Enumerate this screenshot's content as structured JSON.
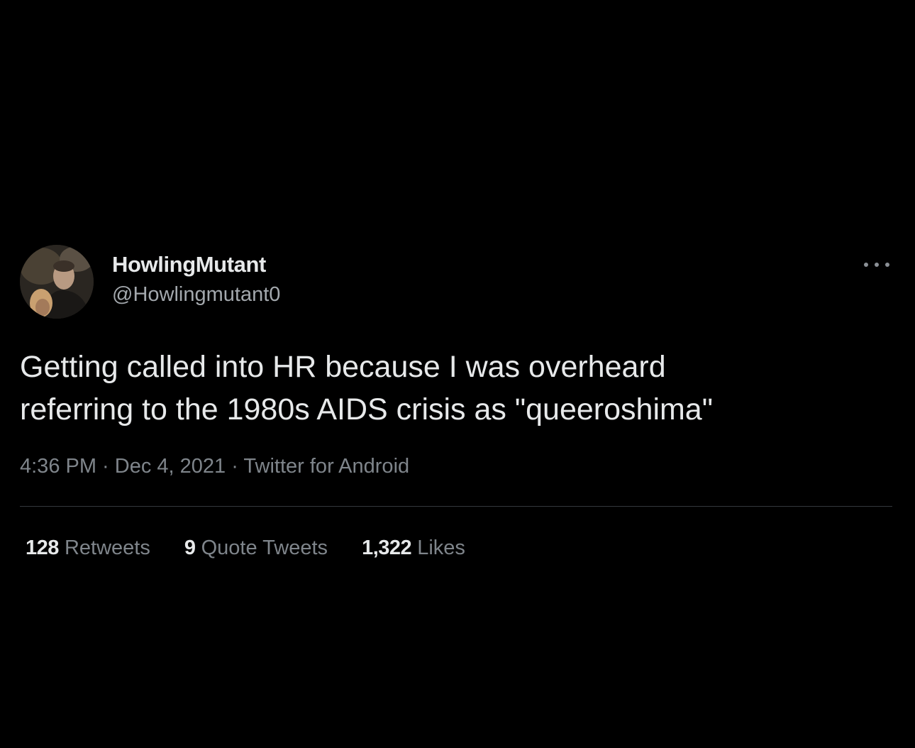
{
  "tweet": {
    "display_name": "HowlingMutant",
    "handle": "@Howlingmutant0",
    "text_lines": [
      "Getting called into HR because I was overheard",
      "referring to the 1980s AIDS crisis as \"queeroshima\""
    ],
    "time": "4:36 PM",
    "date": "Dec 4, 2021",
    "source": "Twitter for Android",
    "separator": " · "
  },
  "stats": {
    "retweets_count": "128",
    "retweets_label": "Retweets",
    "quotes_count": "9",
    "quotes_label": "Quote Tweets",
    "likes_count": "1,322",
    "likes_label": "Likes"
  },
  "icons": {
    "more": "more-horizontal-icon"
  },
  "colors": {
    "background": "#000000",
    "primary_text": "#e7e9ea",
    "secondary_text": "#7f858b",
    "divider": "#34383c"
  }
}
